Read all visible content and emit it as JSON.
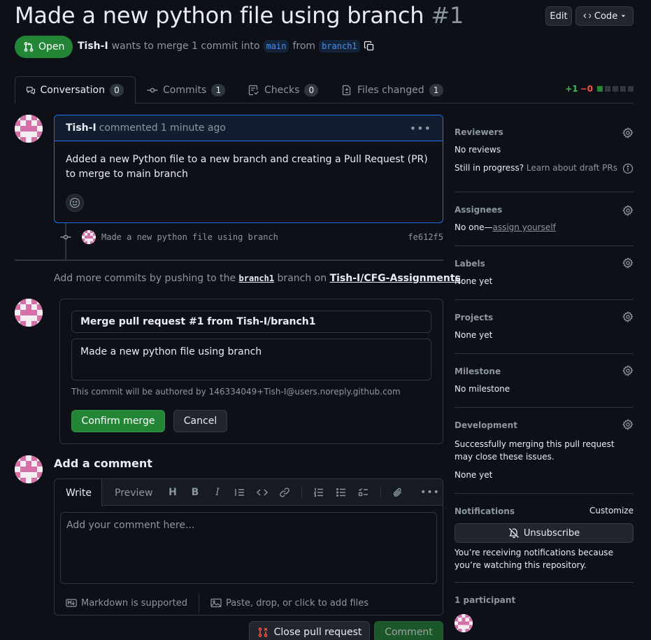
{
  "header": {
    "title": "Made a new python file using branch",
    "number": "#1",
    "edit_label": "Edit",
    "code_label": "Code"
  },
  "status": {
    "state_label": "Open",
    "author": "Tish-I",
    "merge_text": "wants to merge 1 commit into",
    "base_branch": "main",
    "from_text": "from",
    "head_branch": "branch1"
  },
  "tabs": [
    {
      "label": "Conversation",
      "count": "0"
    },
    {
      "label": "Commits",
      "count": "1"
    },
    {
      "label": "Checks",
      "count": "0"
    },
    {
      "label": "Files changed",
      "count": "1"
    }
  ],
  "diffstat": {
    "additions": "+1",
    "deletions": "−0"
  },
  "comment": {
    "author": "Tish-I",
    "action": "commented",
    "time": "1 minute ago",
    "body": "Added a new Python file to a new branch and creating a Pull Request (PR) to merge to main branch"
  },
  "commit": {
    "message": "Made a new python file using branch",
    "sha": "fe612f5"
  },
  "push_hint": {
    "prefix": "Add more commits by pushing to the",
    "branch": "branch1",
    "middle": "branch on",
    "repo": "Tish-I/CFG-Assignments",
    "suffix": "."
  },
  "merge": {
    "title_value": "Merge pull request #1 from Tish-I/branch1",
    "body_value": "Made a new python file using branch",
    "author_hint": "This commit will be authored by 146334049+Tish-I@users.noreply.github.com",
    "confirm_label": "Confirm merge",
    "cancel_label": "Cancel"
  },
  "add_comment": {
    "title": "Add a comment",
    "write_tab": "Write",
    "preview_tab": "Preview",
    "placeholder": "Add your comment here...",
    "markdown_label": "Markdown is supported",
    "attach_label": "Paste, drop, or click to add files",
    "close_label": "Close pull request",
    "comment_label": "Comment"
  },
  "sidebar": {
    "reviewers": {
      "title": "Reviewers",
      "value": "No reviews",
      "progress": "Still in progress?",
      "draft_link": "Learn about draft PRs"
    },
    "assignees": {
      "title": "Assignees",
      "value_prefix": "No one—",
      "assign_link": "assign yourself"
    },
    "labels": {
      "title": "Labels",
      "value": "None yet"
    },
    "projects": {
      "title": "Projects",
      "value": "None yet"
    },
    "milestone": {
      "title": "Milestone",
      "value": "No milestone"
    },
    "development": {
      "title": "Development",
      "desc": "Successfully merging this pull request may close these issues.",
      "value": "None yet"
    },
    "notifications": {
      "title": "Notifications",
      "customize": "Customize",
      "unsubscribe": "Unsubscribe",
      "desc": "You’re receiving notifications because you’re watching this repository."
    },
    "participants": {
      "title": "1 participant"
    }
  },
  "colors": {
    "accent_green": "#238636",
    "link_blue": "#4493f8",
    "bg": "#0d1117"
  }
}
